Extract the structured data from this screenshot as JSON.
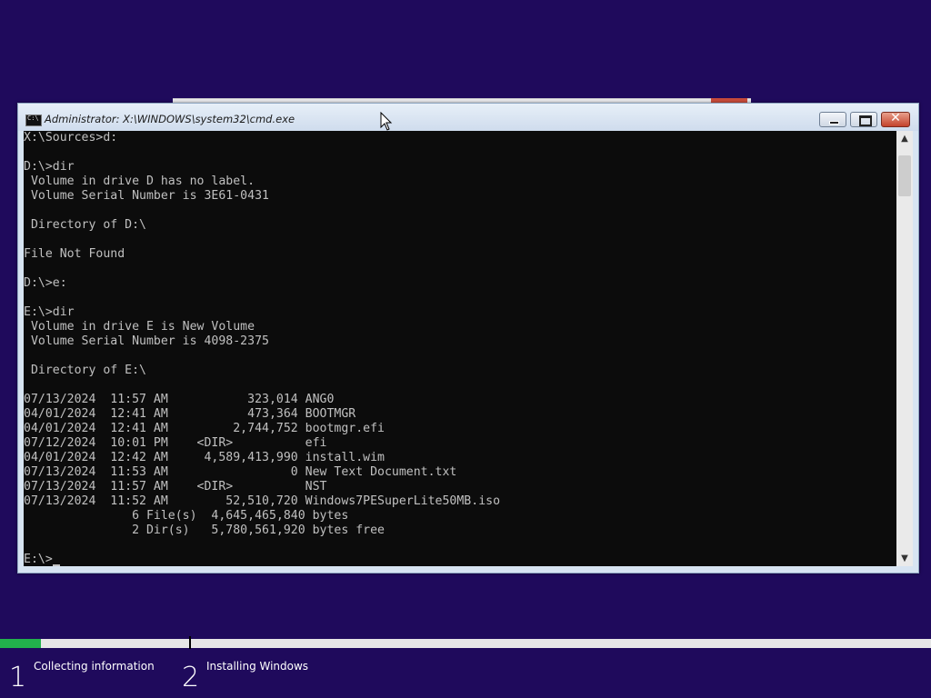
{
  "cmd_window": {
    "title": "Administrator: X:\\WINDOWS\\system32\\cmd.exe",
    "console_lines": [
      "X:\\Sources>d:",
      "",
      "D:\\>dir",
      " Volume in drive D has no label.",
      " Volume Serial Number is 3E61-0431",
      "",
      " Directory of D:\\",
      "",
      "File Not Found",
      "",
      "D:\\>e:",
      "",
      "E:\\>dir",
      " Volume in drive E is New Volume",
      " Volume Serial Number is 4098-2375",
      "",
      " Directory of E:\\",
      "",
      "07/13/2024  11:57 AM           323,014 ANG0",
      "04/01/2024  12:41 AM           473,364 BOOTMGR",
      "04/01/2024  12:41 AM         2,744,752 bootmgr.efi",
      "07/12/2024  10:01 PM    <DIR>          efi",
      "04/01/2024  12:42 AM     4,589,413,990 install.wim",
      "07/13/2024  11:53 AM                 0 New Text Document.txt",
      "07/13/2024  11:57 AM    <DIR>          NST",
      "07/13/2024  11:52 AM        52,510,720 Windows7PESuperLite50MB.iso",
      "               6 File(s)  4,645,465,840 bytes",
      "               2 Dir(s)   5,780,561,920 bytes free",
      ""
    ],
    "prompt": "E:\\>"
  },
  "setup": {
    "progress_fraction": 0.044,
    "steps": [
      {
        "number": "1",
        "label": "Collecting information"
      },
      {
        "number": "2",
        "label": "Installing Windows"
      }
    ]
  },
  "colors": {
    "background": "#1f0a5c",
    "progress_fill": "#22b14c",
    "console_bg": "#0c0c0c",
    "console_fg": "#c0c0c0"
  },
  "icons": [
    "cmd-icon",
    "minimize-icon",
    "maximize-icon",
    "close-icon",
    "scroll-up-icon",
    "scroll-down-icon",
    "mouse-pointer-icon"
  ]
}
